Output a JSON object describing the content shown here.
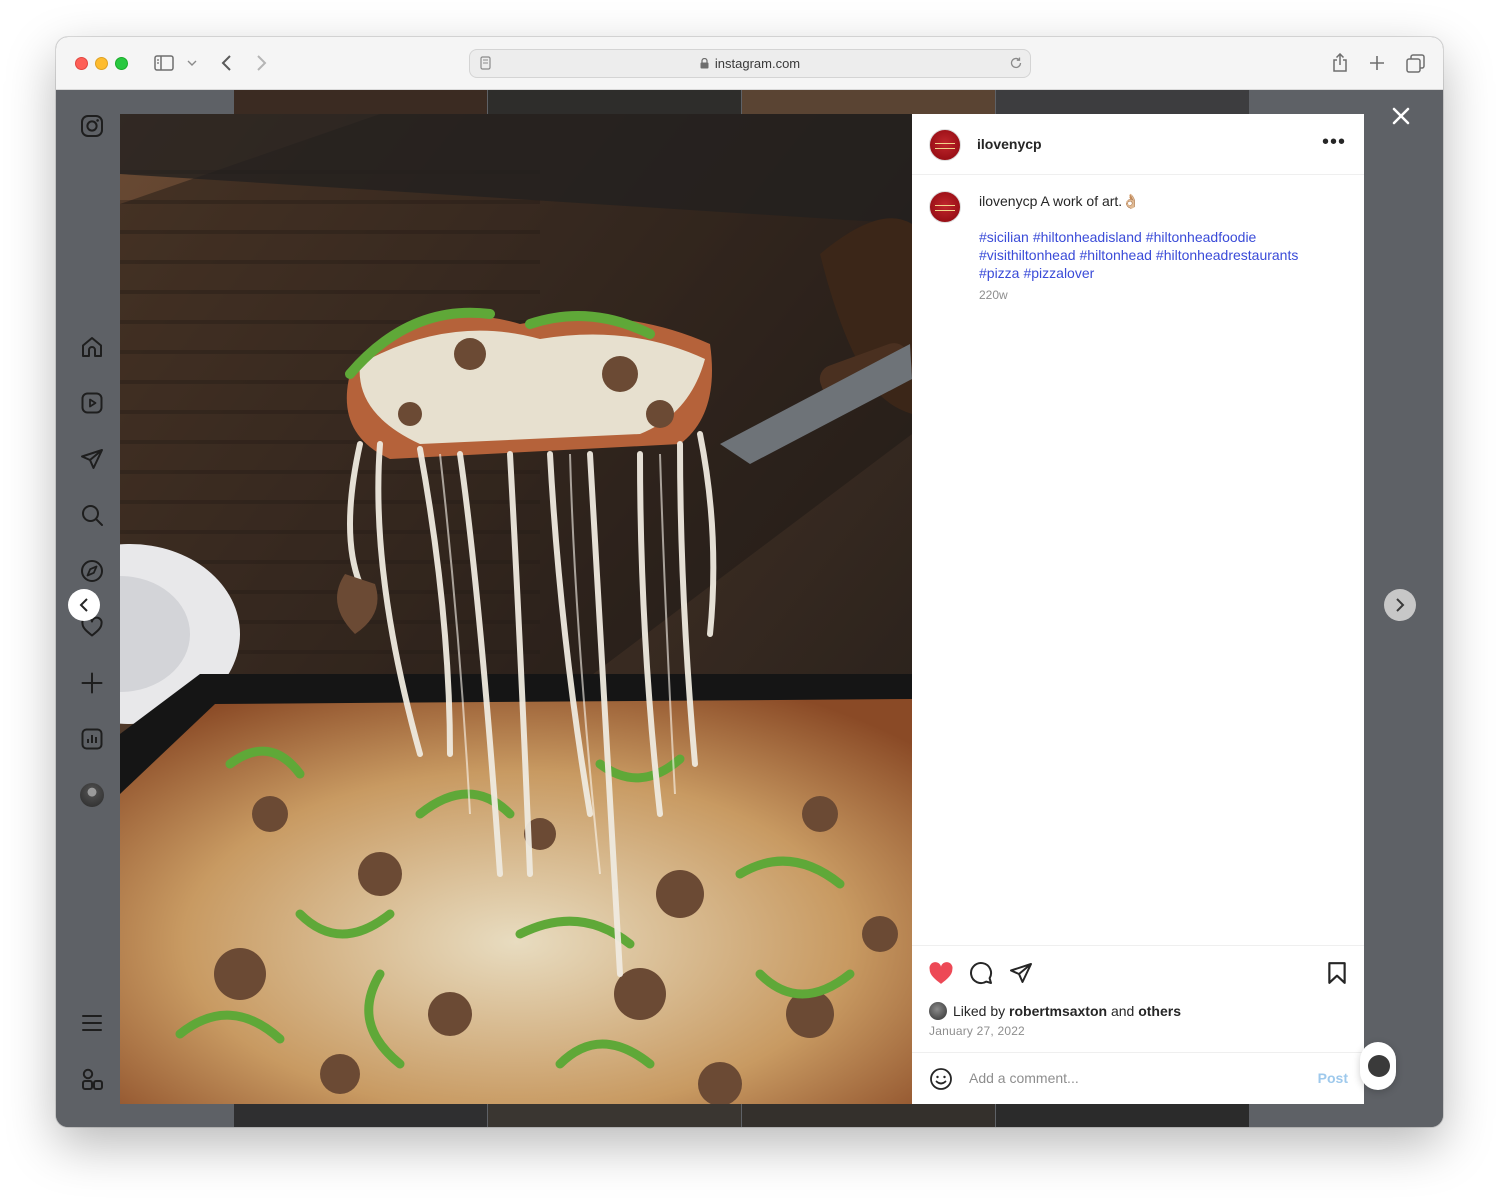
{
  "browser": {
    "url": "instagram.com"
  },
  "sidebar": {
    "items": [
      {
        "icon": "instagram-logo-icon"
      },
      {
        "icon": "home-icon"
      },
      {
        "icon": "reels-icon"
      },
      {
        "icon": "direct-message-icon"
      },
      {
        "icon": "search-icon"
      },
      {
        "icon": "explore-compass-icon"
      },
      {
        "icon": "notifications-heart-icon"
      },
      {
        "icon": "create-plus-icon"
      },
      {
        "icon": "dashboard-chart-icon"
      },
      {
        "icon": "profile-avatar-icon"
      },
      {
        "icon": "menu-icon"
      },
      {
        "icon": "threads-apps-icon"
      }
    ]
  },
  "post": {
    "username": "ilovenycp",
    "caption_user": "ilovenycp",
    "caption_text": "A work of art.👌🏼",
    "hashtags": [
      "#sicilian",
      "#hiltonheadisland",
      "#hiltonheadfoodie",
      "#visithiltonhead",
      "#hiltonhead",
      "#hiltonheadrestaurants",
      "#pizza",
      "#pizzalover"
    ],
    "age": "220w",
    "liked_prefix": "Liked by",
    "liked_user": "robertmsaxton",
    "liked_and": "and",
    "liked_others": "others",
    "date": "January 27, 2022",
    "comment_placeholder": "Add a comment...",
    "post_label": "Post",
    "more_label": "•••",
    "liked": true
  },
  "colors": {
    "heart": "#ed4956",
    "hashtag": "#3a4bd8",
    "overlay": "#5e6166"
  }
}
